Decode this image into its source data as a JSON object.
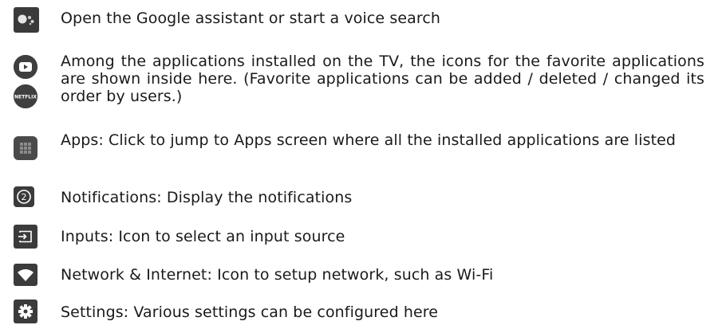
{
  "items": [
    {
      "icon": "google-assistant-icon",
      "text": "Open the Google assistant or start a voice search"
    },
    {
      "icon": "favorite-apps-icon",
      "icon_label": "NETFLIX",
      "text": "Among the applications installed on the TV, the icons for the favorite applications are  shown inside here. (Favorite applications can be added / deleted / changed its order by users.)"
    },
    {
      "icon": "apps-grid-icon",
      "text": "Apps: Click to jump to Apps screen where all the installed applications are listed"
    },
    {
      "icon": "notifications-icon",
      "icon_label": "2",
      "text": "Notifications: Display the notifications"
    },
    {
      "icon": "input-source-icon",
      "text": "Inputs: Icon to select an input source"
    },
    {
      "icon": "wifi-icon",
      "text": "Network & Internet: Icon to setup network, such as Wi-Fi"
    },
    {
      "icon": "gear-icon",
      "text": "Settings: Various settings can be configured here"
    }
  ],
  "colors": {
    "icon_bg": "#3b3b3b",
    "icon_fg": "#ffffff",
    "text": "#1a1a1a",
    "assistant_dot": "#d9d9d9"
  }
}
